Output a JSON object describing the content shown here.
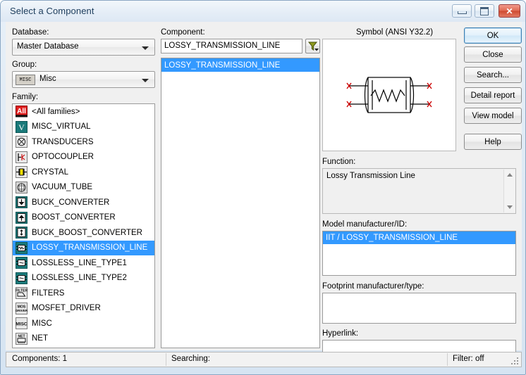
{
  "window": {
    "title": "Select a Component",
    "controls": {
      "minimize": "minimize-button",
      "maximize": "maximize-button",
      "close": "✕"
    }
  },
  "left": {
    "database_label": "Database:",
    "database_value": "Master Database",
    "group_label": "Group:",
    "group_value": "Misc",
    "group_icon_text": "MISC",
    "family_label": "Family:",
    "families": [
      {
        "label": "<All families>",
        "icon": "all-families-icon",
        "icon_text": "All",
        "selected": false
      },
      {
        "label": "MISC_VIRTUAL",
        "icon": "misc-virtual-icon",
        "icon_text": "V",
        "selected": false
      },
      {
        "label": "TRANSDUCERS",
        "icon": "transducers-icon",
        "icon_text": "",
        "selected": false
      },
      {
        "label": "OPTOCOUPLER",
        "icon": "optocoupler-icon",
        "icon_text": "",
        "selected": false
      },
      {
        "label": "CRYSTAL",
        "icon": "crystal-icon",
        "icon_text": "",
        "selected": false
      },
      {
        "label": "VACUUM_TUBE",
        "icon": "vacuum-tube-icon",
        "icon_text": "",
        "selected": false
      },
      {
        "label": "BUCK_CONVERTER",
        "icon": "buck-converter-icon",
        "icon_text": "",
        "selected": false
      },
      {
        "label": "BOOST_CONVERTER",
        "icon": "boost-converter-icon",
        "icon_text": "",
        "selected": false
      },
      {
        "label": "BUCK_BOOST_CONVERTER",
        "icon": "buck-boost-converter-icon",
        "icon_text": "",
        "selected": false
      },
      {
        "label": "LOSSY_TRANSMISSION_LINE",
        "icon": "lossy-transmission-line-icon",
        "icon_text": "",
        "selected": true
      },
      {
        "label": "LOSSLESS_LINE_TYPE1",
        "icon": "lossless-line-type1-icon",
        "icon_text": "",
        "selected": false
      },
      {
        "label": "LOSSLESS_LINE_TYPE2",
        "icon": "lossless-line-type2-icon",
        "icon_text": "",
        "selected": false
      },
      {
        "label": "FILTERS",
        "icon": "filters-icon",
        "icon_text": "FILTER",
        "selected": false
      },
      {
        "label": "MOSFET_DRIVER",
        "icon": "mosfet-driver-icon",
        "icon_text": "MOS",
        "selected": false
      },
      {
        "label": "MISC",
        "icon": "misc-icon",
        "icon_text": "MISC",
        "selected": false
      },
      {
        "label": "NET",
        "icon": "net-icon",
        "icon_text": "NET",
        "selected": false
      }
    ]
  },
  "middle": {
    "component_label": "Component:",
    "component_search_value": "LOSSY_TRANSMISSION_LINE",
    "component_search_placeholder": "",
    "filter_button": "filter-funnel-icon",
    "components": [
      {
        "label": "LOSSY_TRANSMISSION_LINE",
        "selected": true
      }
    ]
  },
  "right": {
    "symbol_title": "Symbol (ANSI Y32.2)",
    "function_label": "Function:",
    "function_value": "Lossy Transmission Line",
    "model_label": "Model manufacturer/ID:",
    "model_value": "IIT / LOSSY_TRANSMISSION_LINE",
    "footprint_label": "Footprint manufacturer/type:",
    "footprint_value": "",
    "hyperlink_label": "Hyperlink:",
    "hyperlink_value": ""
  },
  "buttons": {
    "ok": "OK",
    "close": "Close",
    "search": "Search...",
    "detail_report": "Detail report",
    "view_model": "View model",
    "help": "Help"
  },
  "statusbar": {
    "components": "Components: 1",
    "searching": "Searching:",
    "filter": "Filter: off"
  },
  "colors": {
    "selection_blue": "#3399ff",
    "teal_icon": "#1a7a7a",
    "title_text": "#1d3d5c",
    "close_red": "#cf4a30"
  }
}
